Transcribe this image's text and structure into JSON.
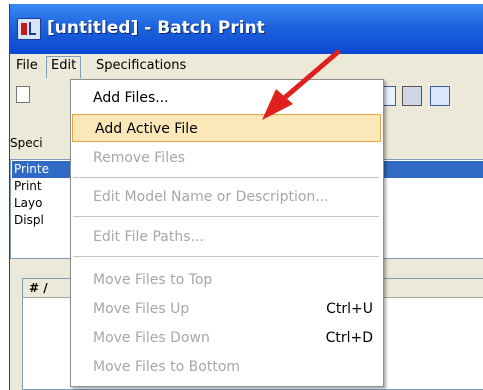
{
  "window": {
    "title": "[untitled] - Batch Print"
  },
  "menubar": {
    "file": "File",
    "edit": "Edit",
    "specifications": "Specifications"
  },
  "specs": {
    "label": "Speci",
    "rows": [
      "Printe",
      "Print",
      "Layo",
      "Displ"
    ]
  },
  "files": {
    "header": "# /"
  },
  "edit_menu": {
    "items": [
      {
        "label": "Add Files...",
        "shortcut": "",
        "enabled": true
      },
      {
        "label": "Add Active File",
        "shortcut": "",
        "enabled": true,
        "highlighted": true
      },
      {
        "label": "Remove Files",
        "shortcut": "",
        "enabled": false
      },
      {
        "label": "Edit Model Name or Description...",
        "shortcut": "",
        "enabled": false
      },
      {
        "label": "Edit File Paths...",
        "shortcut": "",
        "enabled": false
      },
      {
        "label": "Move Files to Top",
        "shortcut": "",
        "enabled": false
      },
      {
        "label": "Move Files Up",
        "shortcut": "Ctrl+U",
        "enabled": false
      },
      {
        "label": "Move Files Down",
        "shortcut": "Ctrl+D",
        "enabled": false
      },
      {
        "label": "Move Files to Bottom",
        "shortcut": "",
        "enabled": false
      }
    ]
  },
  "colors": {
    "titlebar": "#0a48d2",
    "selection": "#316ac5",
    "highlight": "#fbe7b8",
    "arrow": "#e0201c"
  }
}
